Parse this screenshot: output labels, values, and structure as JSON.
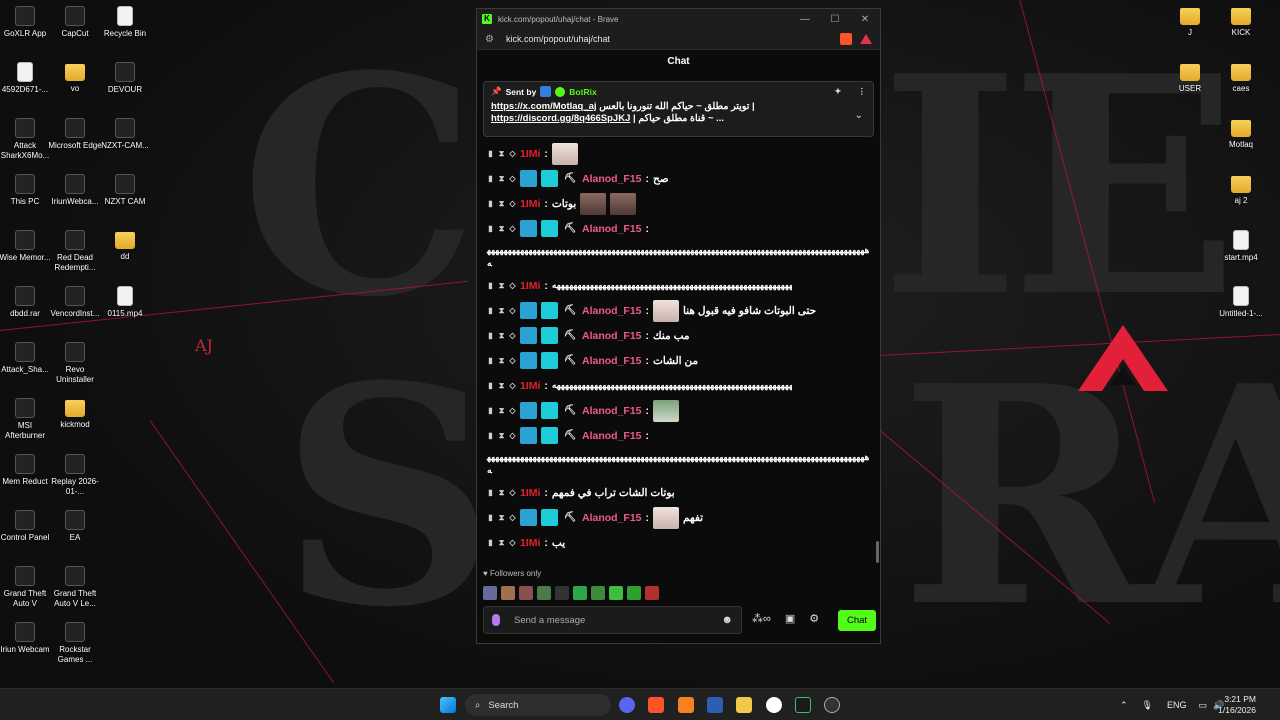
{
  "desktop": {
    "left_icons": [
      {
        "label": "GoXLR App"
      },
      {
        "label": "CapCut"
      },
      {
        "label": "Recycle Bin"
      },
      {
        "label": "4592D671-..."
      },
      {
        "label": "vo"
      },
      {
        "label": "DEVOUR"
      },
      {
        "label": "Attack SharkX6Mo..."
      },
      {
        "label": "Microsoft Edge"
      },
      {
        "label": "NZXT-CAM..."
      },
      {
        "label": "This PC"
      },
      {
        "label": "IriunWebca..."
      },
      {
        "label": "NZXT CAM"
      },
      {
        "label": "Wise Memor..."
      },
      {
        "label": "Red Dead Redempti..."
      },
      {
        "label": "dd"
      },
      {
        "label": "dbdd.rar"
      },
      {
        "label": "VencordInst..."
      },
      {
        "label": "0115.mp4"
      },
      {
        "label": "Attack_Sha..."
      },
      {
        "label": "Revo Uninstaller"
      },
      {
        "label": "MSI Afterburner"
      },
      {
        "label": "kickmod"
      },
      {
        "label": "Mem Reduct"
      },
      {
        "label": "Replay 2026-01-..."
      },
      {
        "label": "Control Panel"
      },
      {
        "label": "EA"
      },
      {
        "label": "Grand Theft Auto V"
      },
      {
        "label": "Grand Theft Auto V Le..."
      },
      {
        "label": "Iriun Webcam"
      },
      {
        "label": "Rockstar Games ..."
      }
    ],
    "right_icons": [
      {
        "label": "J"
      },
      {
        "label": "KICK"
      },
      {
        "label": "USER"
      },
      {
        "label": "caes"
      },
      {
        "label": "Motlaq"
      },
      {
        "label": "aj 2"
      },
      {
        "label": "start.mp4"
      },
      {
        "label": "Untitled-1-..."
      }
    ],
    "wallpaper_aj": "AJ"
  },
  "browser": {
    "title": "kick.com/popout/uhaj/chat - Brave",
    "url": "kick.com/popout/uhaj/chat",
    "window_controls": {
      "minimize": "—",
      "maximize": "☐",
      "close": "✕"
    }
  },
  "chat": {
    "header": "Chat",
    "pinned": {
      "sent_by": "Sent by",
      "bot_name": "BotRix",
      "line1_link": "https://x.com/Motlaq_aj",
      "line1_text": "تويتر مطلق ~ حياكم الله تنورونا بالعس |",
      "line2_link": "https://discord.gg/8q466SpJKJ",
      "line2_text": "| قناة مطلق حياكم ~ ..."
    },
    "user_a": "1IMi",
    "user_b": "Alanod_F15",
    "messages": [
      {
        "text": "صح"
      },
      {
        "text": "بوتات"
      },
      {
        "long": "ههههههههههههههههههههههههههههههههههههههههههههههههههههههههههههههههههههههههههههههههههههههههههههه"
      },
      {
        "long_inline": "ههههههههههههههههههههههههههههههههههههههههههههههههههههههههههه"
      },
      {
        "text": "حتى البوتات شافو فيه قبول هنا"
      },
      {
        "text": "مب منك"
      },
      {
        "text": "من الشات"
      },
      {
        "long_inline2": "ههههههههههههههههههههههههههههههههههههههههههههههههههههههههههههه"
      },
      {
        "text": "بوتات الشات تراب في فمهم"
      },
      {
        "text": "تفهم"
      },
      {
        "text": "يب"
      }
    ],
    "followers_only": "Followers only",
    "input_placeholder": "Send a message",
    "chat_button": "Chat"
  },
  "taskbar": {
    "search": "Search",
    "language": "ENG",
    "time": "3:21 PM",
    "date": "1/16/2026"
  }
}
